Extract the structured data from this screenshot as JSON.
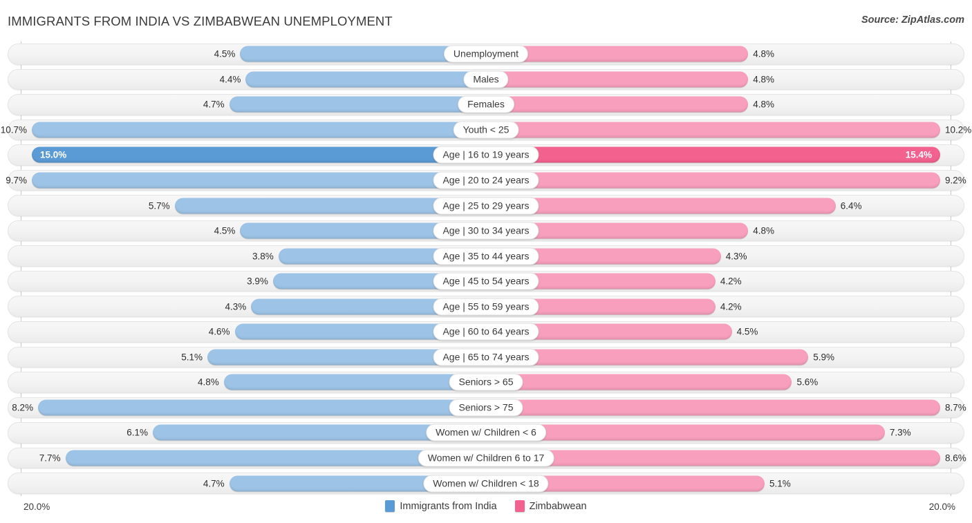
{
  "header": {
    "title": "IMMIGRANTS FROM INDIA VS ZIMBABWEAN UNEMPLOYMENT",
    "source": "Source: ZipAtlas.com"
  },
  "footer": {
    "axis_max_left": "20.0%",
    "axis_max_right": "20.0%",
    "legend": [
      {
        "label": "Immigrants from India",
        "color": "#5b9bd5"
      },
      {
        "label": "Zimbabwean",
        "color": "#f3618f"
      }
    ]
  },
  "colors": {
    "left_normal": "#9dc3e6",
    "left_highlight": "#5b9bd5",
    "right_normal": "#f79fbc",
    "right_highlight": "#f3618f",
    "track": "#f3f3f3"
  },
  "chart_data": {
    "type": "bar",
    "title": "IMMIGRANTS FROM INDIA VS ZIMBABWEAN UNEMPLOYMENT",
    "subtitle": "Source: ZipAtlas.com",
    "orientation": "horizontal-diverging",
    "xlabel": "",
    "ylabel": "",
    "xlim": [
      20.0,
      20.0
    ],
    "axis_max_left": 20.0,
    "axis_max_right": 20.0,
    "unit": "%",
    "grid": false,
    "legend_position": "bottom-center",
    "categories": [
      "Unemployment",
      "Males",
      "Females",
      "Youth < 25",
      "Age | 16 to 19 years",
      "Age | 20 to 24 years",
      "Age | 25 to 29 years",
      "Age | 30 to 34 years",
      "Age | 35 to 44 years",
      "Age | 45 to 54 years",
      "Age | 55 to 59 years",
      "Age | 60 to 64 years",
      "Age | 65 to 74 years",
      "Seniors > 65",
      "Seniors > 75",
      "Women w/ Children < 6",
      "Women w/ Children 6 to 17",
      "Women w/ Children < 18"
    ],
    "series": [
      {
        "name": "Immigrants from India",
        "side": "left",
        "color": "#9dc3e6",
        "values": [
          4.5,
          4.4,
          4.7,
          10.7,
          15.0,
          9.7,
          5.7,
          4.5,
          3.8,
          3.9,
          4.3,
          4.6,
          5.1,
          4.8,
          8.2,
          6.1,
          7.7,
          4.7
        ]
      },
      {
        "name": "Zimbabwean",
        "side": "right",
        "color": "#f79fbc",
        "values": [
          4.8,
          4.8,
          4.8,
          10.2,
          15.4,
          9.2,
          6.4,
          4.8,
          4.3,
          4.2,
          4.2,
          4.5,
          5.9,
          5.6,
          8.7,
          7.3,
          8.6,
          5.1
        ]
      }
    ],
    "highlight_row_index": 4
  },
  "rows": [
    {
      "label": "Unemployment",
      "left": "4.5%",
      "right": "4.8%",
      "lv": 4.5,
      "rv": 4.8,
      "hl": false
    },
    {
      "label": "Males",
      "left": "4.4%",
      "right": "4.8%",
      "lv": 4.4,
      "rv": 4.8,
      "hl": false
    },
    {
      "label": "Females",
      "left": "4.7%",
      "right": "4.8%",
      "lv": 4.7,
      "rv": 4.8,
      "hl": false
    },
    {
      "label": "Youth < 25",
      "left": "10.7%",
      "right": "10.2%",
      "lv": 10.7,
      "rv": 10.2,
      "hl": false
    },
    {
      "label": "Age | 16 to 19 years",
      "left": "15.0%",
      "right": "15.4%",
      "lv": 15.0,
      "rv": 15.4,
      "hl": true
    },
    {
      "label": "Age | 20 to 24 years",
      "left": "9.7%",
      "right": "9.2%",
      "lv": 9.7,
      "rv": 9.2,
      "hl": false
    },
    {
      "label": "Age | 25 to 29 years",
      "left": "5.7%",
      "right": "6.4%",
      "lv": 5.7,
      "rv": 6.4,
      "hl": false
    },
    {
      "label": "Age | 30 to 34 years",
      "left": "4.5%",
      "right": "4.8%",
      "lv": 4.5,
      "rv": 4.8,
      "hl": false
    },
    {
      "label": "Age | 35 to 44 years",
      "left": "3.8%",
      "right": "4.3%",
      "lv": 3.8,
      "rv": 4.3,
      "hl": false
    },
    {
      "label": "Age | 45 to 54 years",
      "left": "3.9%",
      "right": "4.2%",
      "lv": 3.9,
      "rv": 4.2,
      "hl": false
    },
    {
      "label": "Age | 55 to 59 years",
      "left": "4.3%",
      "right": "4.2%",
      "lv": 4.3,
      "rv": 4.2,
      "hl": false
    },
    {
      "label": "Age | 60 to 64 years",
      "left": "4.6%",
      "right": "4.5%",
      "lv": 4.6,
      "rv": 4.5,
      "hl": false
    },
    {
      "label": "Age | 65 to 74 years",
      "left": "5.1%",
      "right": "5.9%",
      "lv": 5.1,
      "rv": 5.9,
      "hl": false
    },
    {
      "label": "Seniors > 65",
      "left": "4.8%",
      "right": "5.6%",
      "lv": 4.8,
      "rv": 5.6,
      "hl": false
    },
    {
      "label": "Seniors > 75",
      "left": "8.2%",
      "right": "8.7%",
      "lv": 8.2,
      "rv": 8.7,
      "hl": false
    },
    {
      "label": "Women w/ Children < 6",
      "left": "6.1%",
      "right": "7.3%",
      "lv": 6.1,
      "rv": 7.3,
      "hl": false
    },
    {
      "label": "Women w/ Children 6 to 17",
      "left": "7.7%",
      "right": "8.6%",
      "lv": 7.7,
      "rv": 8.6,
      "hl": false
    },
    {
      "label": "Women w/ Children < 18",
      "left": "4.7%",
      "right": "5.1%",
      "lv": 4.7,
      "rv": 5.1,
      "hl": false
    }
  ]
}
